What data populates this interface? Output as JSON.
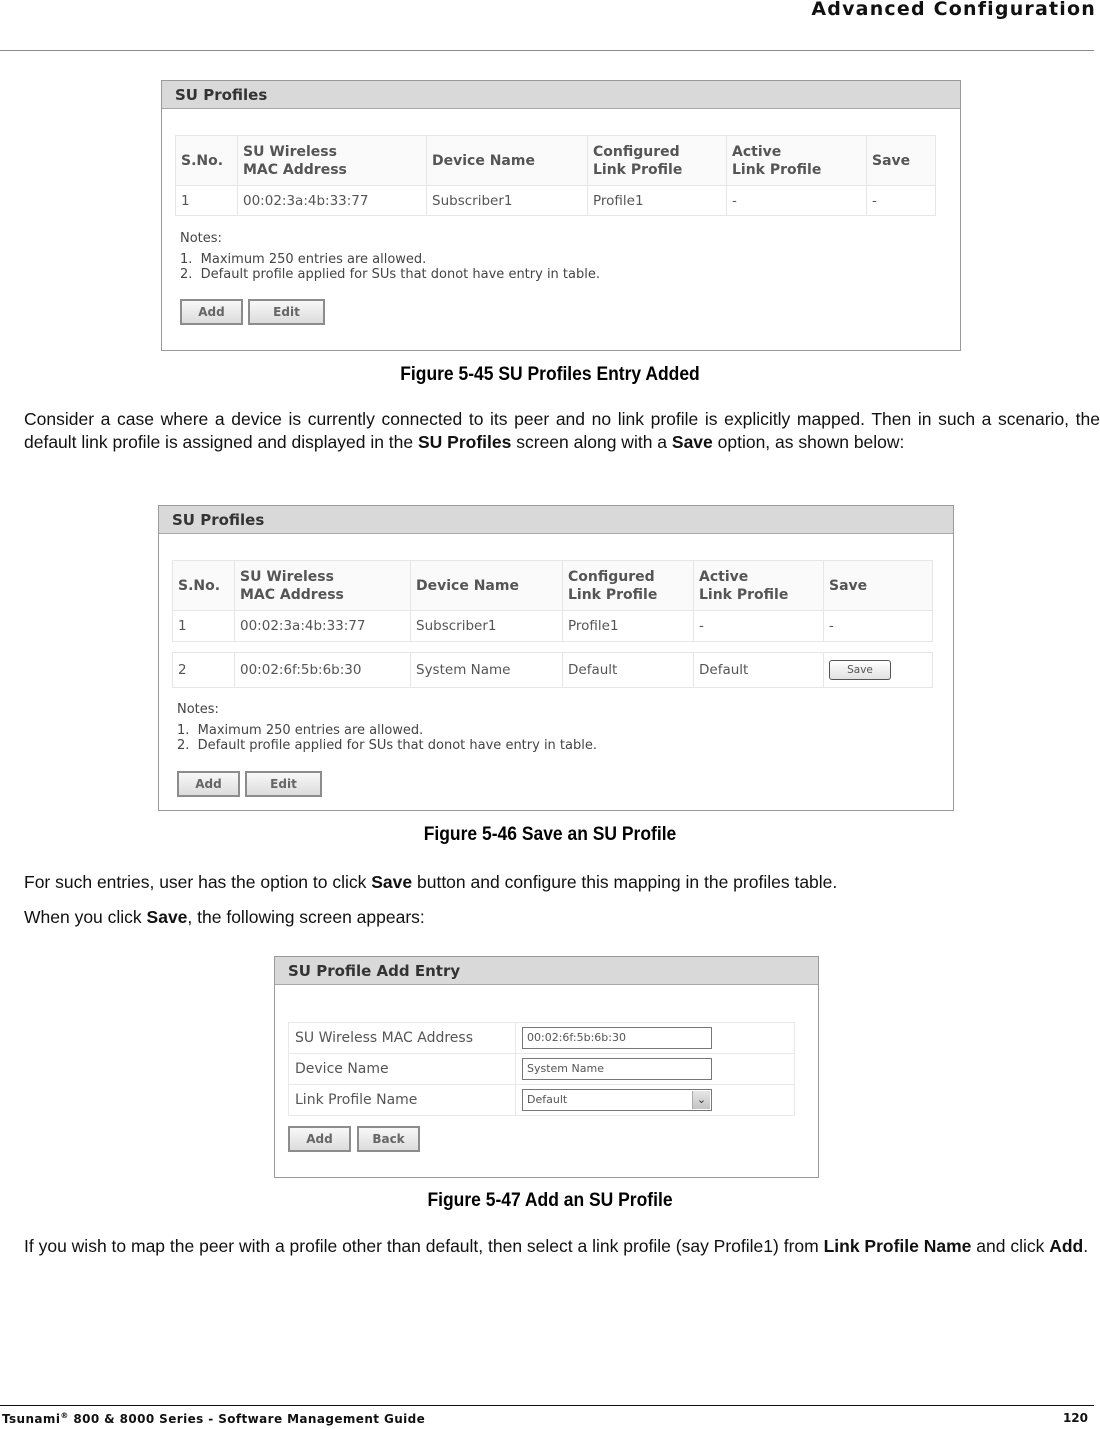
{
  "header": {
    "title": "Advanced Configuration"
  },
  "figure45": {
    "panel_title": "SU Profiles",
    "columns": [
      "S.No.",
      "SU Wireless\nMAC Address",
      "Device Name",
      "Configured\nLink Profile",
      "Active\nLink Profile",
      "Save"
    ],
    "col_lines": [
      [
        "S.No."
      ],
      [
        "SU Wireless",
        "MAC Address"
      ],
      [
        "Device Name"
      ],
      [
        "Configured",
        "Link Profile"
      ],
      [
        "Active",
        "Link Profile"
      ],
      [
        "Save"
      ]
    ],
    "rows": [
      {
        "sno": "1",
        "mac": "00:02:3a:4b:33:77",
        "device": "Subscriber1",
        "configured": "Profile1",
        "active": "-",
        "save": "-"
      }
    ],
    "notes_heading": "Notes:",
    "notes": [
      "1.  Maximum 250 entries are allowed.",
      "2.  Default profile applied for SUs that donot have entry in table."
    ],
    "add_label": "Add",
    "edit_label": "Edit",
    "caption": "Figure 5-45 SU Profiles Entry Added"
  },
  "para1": {
    "t1": "Consider a case where a device is currently connected to its peer and no link profile is explicitly mapped. Then in such a scenario, the default link profile is assigned and displayed in the ",
    "b1": "SU Profiles",
    "t2": " screen along with a ",
    "b2": "Save",
    "t3": " option, as shown below:"
  },
  "figure46": {
    "panel_title": "SU Profiles",
    "col_lines": [
      [
        "S.No."
      ],
      [
        "SU Wireless",
        "MAC Address"
      ],
      [
        "Device Name"
      ],
      [
        "Configured",
        "Link Profile"
      ],
      [
        "Active",
        "Link Profile"
      ],
      [
        "Save"
      ]
    ],
    "rows": [
      {
        "sno": "1",
        "mac": "00:02:3a:4b:33:77",
        "device": "Subscriber1",
        "configured": "Profile1",
        "active": "-",
        "save": "-"
      },
      {
        "sno": "2",
        "mac": "00:02:6f:5b:6b:30",
        "device": "System Name",
        "configured": "Default",
        "active": "Default",
        "save_button": "Save"
      }
    ],
    "notes_heading": "Notes:",
    "notes": [
      "1.  Maximum 250 entries are allowed.",
      "2.  Default profile applied for SUs that donot have entry in table."
    ],
    "add_label": "Add",
    "edit_label": "Edit",
    "caption": "Figure 5-46 Save an SU Profile"
  },
  "para2": {
    "t1": "For such entries, user has the option to click ",
    "b1": "Save",
    "t2": " button and configure this mapping in the profiles table."
  },
  "para3": {
    "t1": "When you click ",
    "b1": "Save",
    "t2": ", the following screen appears:"
  },
  "figure47": {
    "panel_title": "SU Profile Add Entry",
    "fields": [
      {
        "label": "SU Wireless MAC Address",
        "value": "00:02:6f:5b:6b:30"
      },
      {
        "label": "Device Name",
        "value": "System Name"
      },
      {
        "label": "Link Profile Name",
        "value": "Default"
      }
    ],
    "add_label": "Add",
    "back_label": "Back",
    "caption": "Figure 5-47 Add an SU Profile"
  },
  "para4": {
    "t1": "If you wish to map the peer with a profile other than default, then select a link profile (say Profile1) from ",
    "b1": "Link Profile Name",
    "t2": " and click ",
    "b2": "Add",
    "t3": "."
  },
  "footer": {
    "product": "Tsunami",
    "reg": "®",
    "rest": " 800 & 8000 Series - Software Management Guide",
    "page": "120"
  }
}
